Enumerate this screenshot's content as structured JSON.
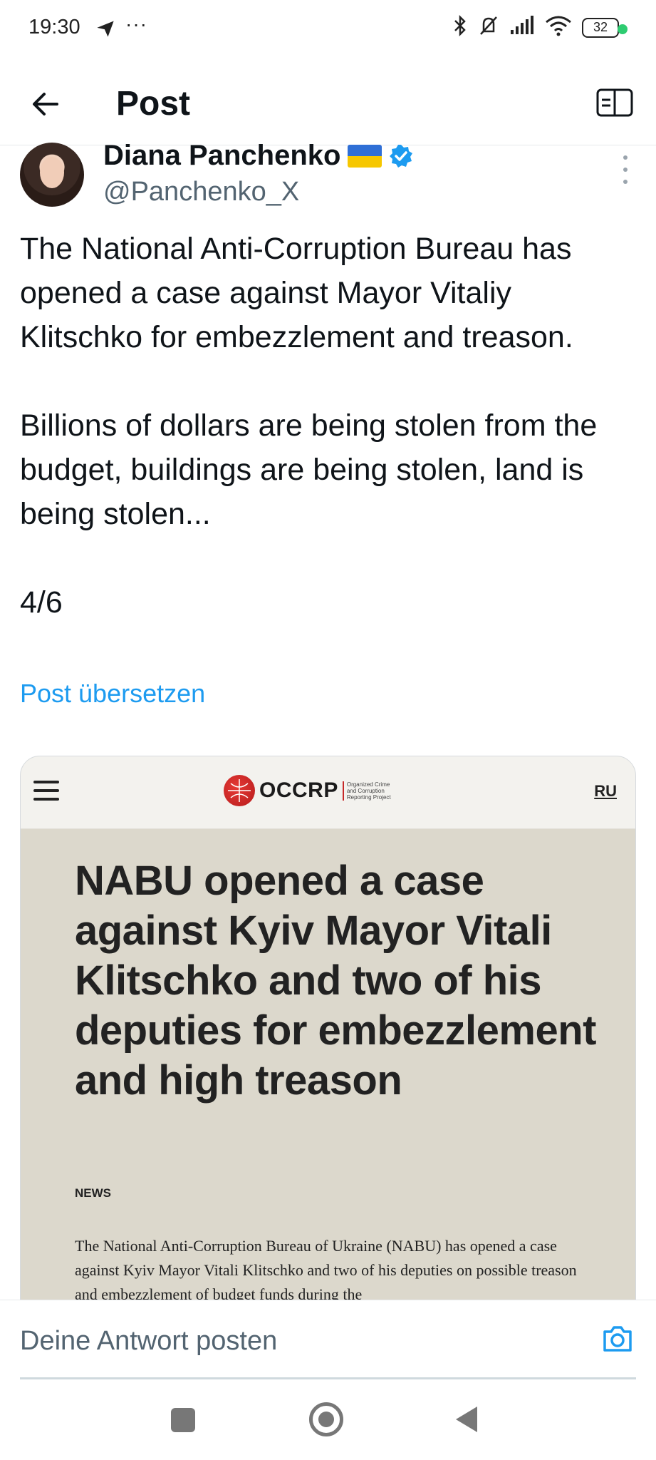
{
  "status_bar": {
    "time": "19:30",
    "dots": "···",
    "battery": "32",
    "icons": [
      "telegram-send-icon",
      "bluetooth-icon",
      "bell-muted-icon",
      "signal-icon",
      "wifi-icon",
      "battery-icon"
    ]
  },
  "header": {
    "title": "Post",
    "icons": [
      "back-arrow-icon",
      "reader-book-icon"
    ]
  },
  "author": {
    "name": "Diana Panchenko",
    "handle": "@Panchenko_X",
    "verified_color": "#1d9bf0"
  },
  "post": {
    "text": "The National Anti-Corruption Bureau has opened a case against Mayor Vitaliy Klitschko for embezzlement and treason.\n\nBillions of dollars are being stolen from the budget, buildings are being stolen, land is being stolen...\n\n4/6",
    "translate_label": "Post übersetzen"
  },
  "card": {
    "logo_text": "OCCRP",
    "logo_subtitle": "Organized Crime and Corruption Reporting Project",
    "lang_link": "RU",
    "headline": "NABU opened a case against Kyiv Mayor Vitali Klitschko and two of his deputies for embezzlement and high treason",
    "tag": "NEWS",
    "excerpt": "The National Anti-Corruption Bureau of Ukraine (NABU) has opened a case against Kyiv Mayor Vitali Klitschko and two of his deputies on possible treason and embezzlement of budget funds during the"
  },
  "reply": {
    "placeholder": "Deine Antwort posten"
  },
  "colors": {
    "link": "#1d9bf0",
    "card_bg": "#dcd8cc",
    "accent_red": "#c62828"
  }
}
